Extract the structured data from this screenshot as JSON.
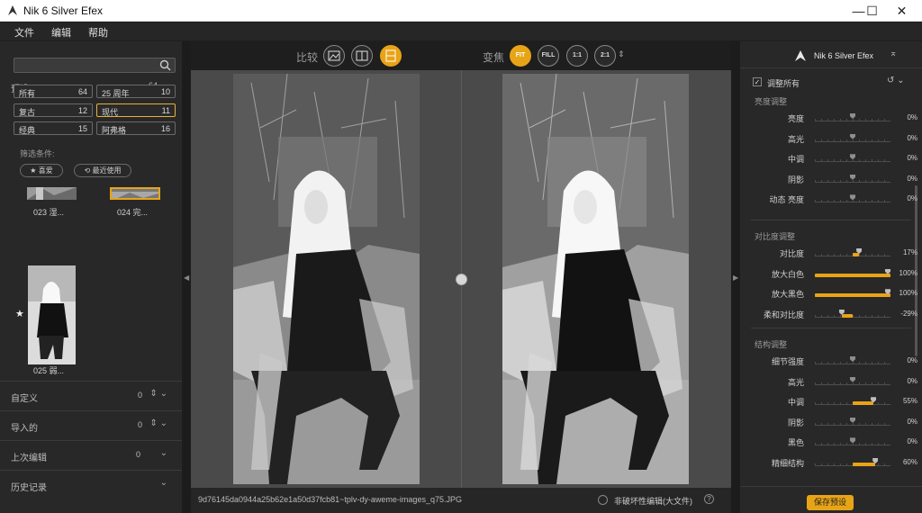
{
  "window": {
    "title": "Nik 6 Silver Efex",
    "minimize": "—",
    "maximize": "☐",
    "close": "✕"
  },
  "menu": [
    "文件",
    "编辑",
    "帮助"
  ],
  "presets": {
    "header": "预设",
    "count": "64",
    "search_placeholder": "",
    "categories": [
      {
        "label": "所有",
        "count": "64",
        "selected": false
      },
      {
        "label": "25 周年",
        "count": "10",
        "selected": false
      },
      {
        "label": "复古",
        "count": "12",
        "selected": false
      },
      {
        "label": "现代",
        "count": "11",
        "selected": true
      },
      {
        "label": "经典",
        "count": "15",
        "selected": false
      },
      {
        "label": "阿弗格",
        "count": "16",
        "selected": false
      }
    ],
    "filter_label": "筛选条件:",
    "filter_favorites": "★ 喜爱",
    "filter_recent": "⟲ 最近使用",
    "thumbnails": [
      "023 湿...",
      "024 完...",
      "025 弱..."
    ],
    "sections": [
      {
        "label": "自定义",
        "count": "0"
      },
      {
        "label": "导入的",
        "count": "0"
      },
      {
        "label": "上次编辑",
        "count": "0"
      },
      {
        "label": "历史记录",
        "count": ""
      }
    ]
  },
  "toolbar": {
    "compare_label": "比较",
    "zoom_label": "变焦",
    "zoom_buttons": [
      "FIT",
      "FILL",
      "1:1",
      "2:1"
    ],
    "active_zoom": "FIT"
  },
  "status": {
    "filename": "9d76145da0944a25b62e1a50d37fcb81~tplv-dy-aweme-images_q75.JPG",
    "nondestructive": "非破坏性编辑(大文件)",
    "help": "?"
  },
  "adjust": {
    "brand": "Nik 6 Silver Efex",
    "adjust_all": "调整所有",
    "groups": [
      {
        "title": "亮度调整",
        "sliders": [
          {
            "label": "亮度",
            "value": "0%",
            "pct": 0
          },
          {
            "label": "高光",
            "value": "0%",
            "pct": 0
          },
          {
            "label": "中调",
            "value": "0%",
            "pct": 0
          },
          {
            "label": "阴影",
            "value": "0%",
            "pct": 0
          },
          {
            "label": "动态 亮度",
            "value": "0%",
            "pct": 0
          }
        ]
      },
      {
        "title": "对比度调整",
        "sliders": [
          {
            "label": "对比度",
            "value": "17%",
            "pct": 17
          },
          {
            "label": "放大白色",
            "value": "100%",
            "pct": 100
          },
          {
            "label": "放大黑色",
            "value": "100%",
            "pct": 100
          },
          {
            "label": "柔和对比度",
            "value": "-29%",
            "pct": -29
          }
        ]
      },
      {
        "title": "结构调整",
        "sliders": [
          {
            "label": "细节强度",
            "value": "0%",
            "pct": 0
          },
          {
            "label": "高光",
            "value": "0%",
            "pct": 0
          },
          {
            "label": "中调",
            "value": "55%",
            "pct": 55
          },
          {
            "label": "阴影",
            "value": "0%",
            "pct": 0
          },
          {
            "label": "黑色",
            "value": "0%",
            "pct": 0
          },
          {
            "label": "精细结构",
            "value": "60%",
            "pct": 60
          }
        ]
      }
    ],
    "save_preset": "保存预设"
  },
  "colors": {
    "accent": "#e8a417",
    "panel": "#282828",
    "preview_bg": "#4a4a4a"
  }
}
